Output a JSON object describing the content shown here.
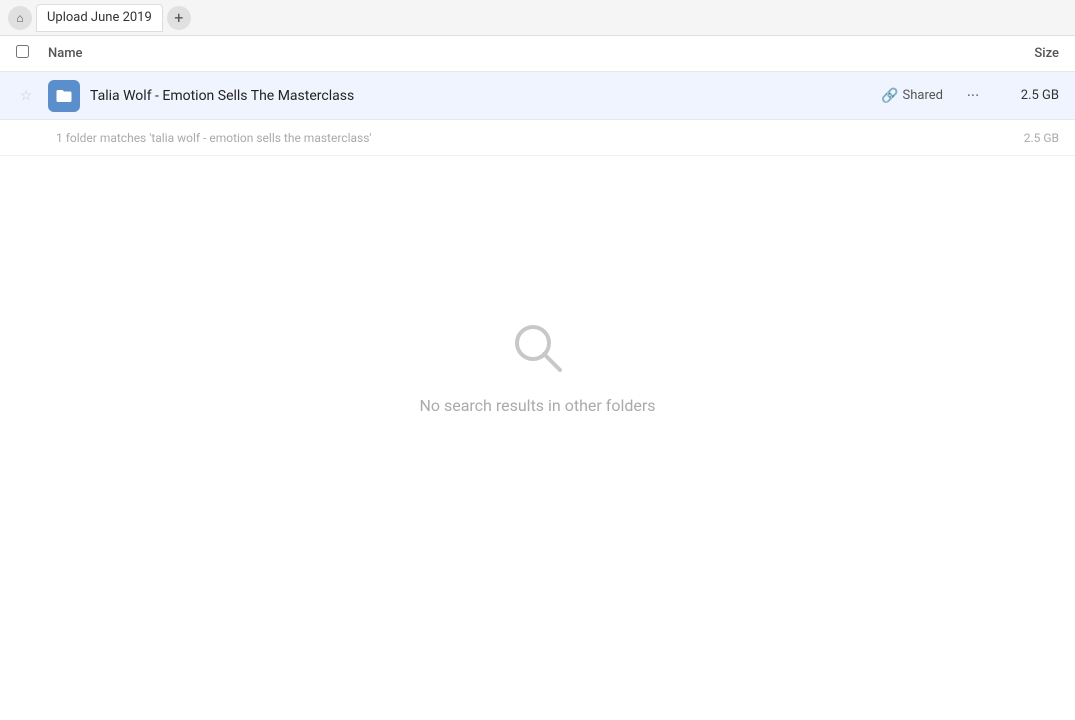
{
  "tabBar": {
    "backLabel": "⌂",
    "tabTitle": "Upload June 2019",
    "addTabLabel": "+"
  },
  "tableHeader": {
    "nameLabel": "Name",
    "sizeLabel": "Size"
  },
  "fileRow": {
    "fileName": "Talia Wolf - Emotion Sells The Masterclass",
    "sharedLabel": "Shared",
    "fileSize": "2.5 GB",
    "moreLabel": "···"
  },
  "matchInfo": {
    "text": "1 folder matches 'talia wolf - emotion sells the masterclass'",
    "size": "2.5 GB"
  },
  "emptyState": {
    "message": "No search results in other folders"
  }
}
